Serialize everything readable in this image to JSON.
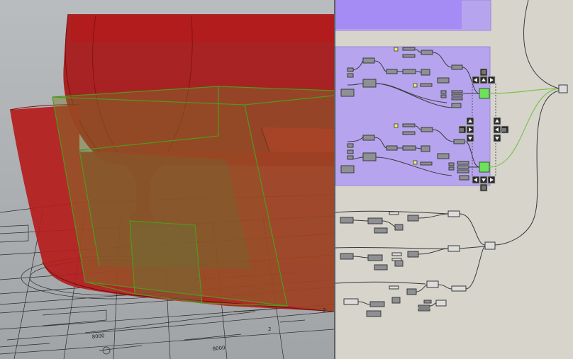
{
  "viewport": {
    "name": "perspective-viewport",
    "drawing_labels": [
      "8000",
      "8000",
      "2",
      "2"
    ],
    "colors": {
      "background": "#a9acae",
      "model": "#b51c1c",
      "selection": "#7a9a3a"
    }
  },
  "canvas": {
    "name": "grasshopper-canvas",
    "colors": {
      "background": "#d7d4cc",
      "group": "#b6a4ee",
      "group_top": "#a58cf5",
      "component": "#8f9094",
      "toggle": "#6ee05a",
      "panel_swatch": "#f2ee58"
    },
    "nav_icons": [
      "arrow-up-icon",
      "arrow-left-icon",
      "arrow-right-icon",
      "arrow-down-icon",
      "list-icon"
    ]
  }
}
